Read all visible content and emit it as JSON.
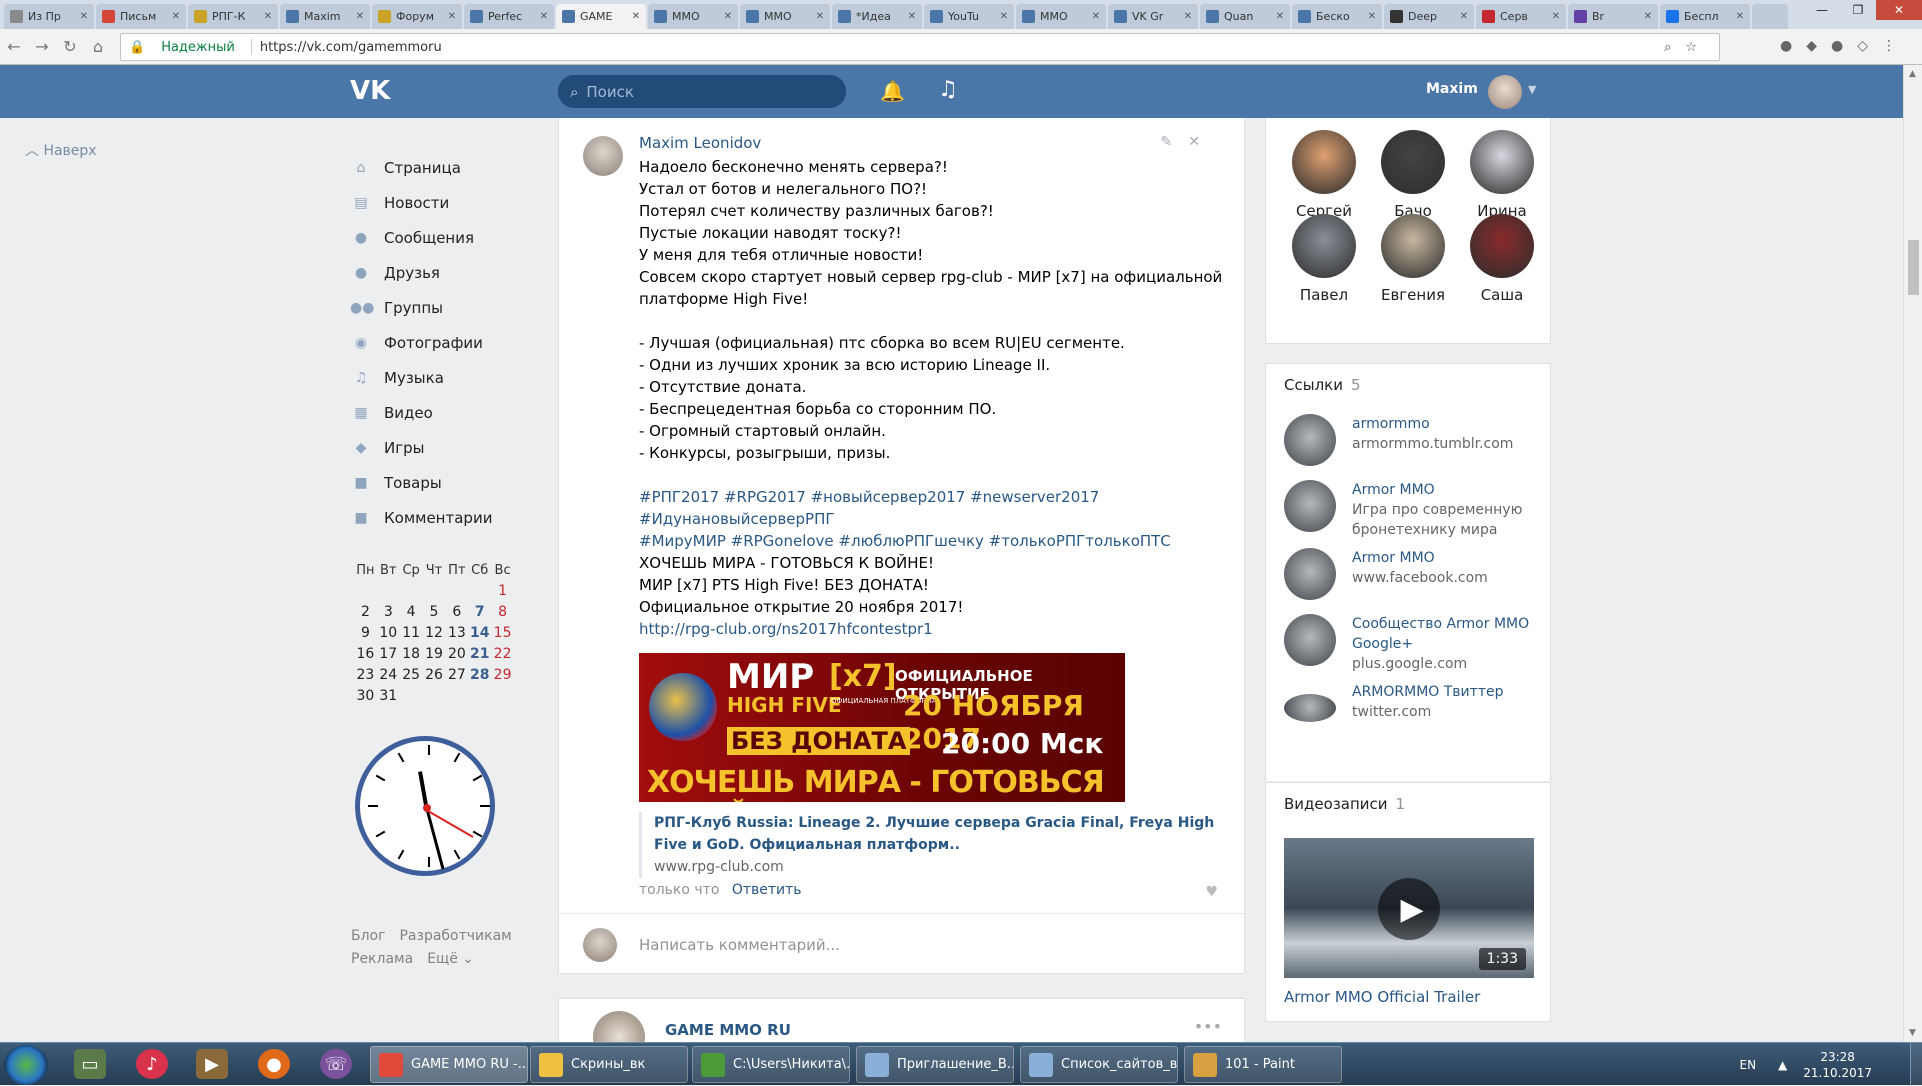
{
  "browser": {
    "tabs": [
      {
        "label": "Из Пр",
        "color": "#8a8a8a"
      },
      {
        "label": "Письм",
        "color": "#d44638"
      },
      {
        "label": "РПГ-К",
        "color": "#c9a227"
      },
      {
        "label": "Maxim",
        "color": "#4a76a8"
      },
      {
        "label": "Форум",
        "color": "#c9a227"
      },
      {
        "label": "Perfec",
        "color": "#4a76a8"
      },
      {
        "label": "GAME",
        "color": "#4a76a8"
      },
      {
        "label": "ММО",
        "color": "#4a76a8"
      },
      {
        "label": "ММО",
        "color": "#4a76a8"
      },
      {
        "label": "*Идеа",
        "color": "#4a76a8"
      },
      {
        "label": "YouTu",
        "color": "#4a76a8"
      },
      {
        "label": "ММО",
        "color": "#4a76a8"
      },
      {
        "label": "VK Gr",
        "color": "#4a76a8"
      },
      {
        "label": "Quan",
        "color": "#4a76a8"
      },
      {
        "label": "Беско",
        "color": "#4a76a8"
      },
      {
        "label": "Deep",
        "color": "#333333"
      },
      {
        "label": "Серв",
        "color": "#c4272d"
      },
      {
        "label": "Br",
        "color": "#6441a5"
      },
      {
        "label": "Беспл",
        "color": "#1a73e8"
      }
    ],
    "active_tab": 6,
    "secure_label": "Надежный",
    "url": "https://vk.com/gamemmoru",
    "window_controls": {
      "minimize": "—",
      "maximize": "❐",
      "close": "✕"
    }
  },
  "vk": {
    "logo": "VK",
    "search_placeholder": "Поиск",
    "user_name": "Maxim",
    "to_top": "Наверх",
    "menu": [
      {
        "label": "Страница",
        "icon": "home-icon",
        "glyph": "⌂"
      },
      {
        "label": "Новости",
        "icon": "news-icon",
        "glyph": "▤"
      },
      {
        "label": "Сообщения",
        "icon": "messages-icon",
        "glyph": "●"
      },
      {
        "label": "Друзья",
        "icon": "friends-icon",
        "glyph": "●"
      },
      {
        "label": "Группы",
        "icon": "groups-icon",
        "glyph": "●●"
      },
      {
        "label": "Фотографии",
        "icon": "camera-icon",
        "glyph": "◉"
      },
      {
        "label": "Музыка",
        "icon": "music-icon",
        "glyph": "♫"
      },
      {
        "label": "Видео",
        "icon": "video-icon",
        "glyph": "▦"
      },
      {
        "label": "Игры",
        "icon": "gamepad-icon",
        "glyph": "◆"
      },
      {
        "label": "Товары",
        "icon": "bag-icon",
        "glyph": "■"
      },
      {
        "label": "Комментарии",
        "icon": "comments-icon",
        "glyph": "■"
      }
    ],
    "calendar": {
      "header": [
        "Пн",
        "Вт",
        "Ср",
        "Чт",
        "Пт",
        "Сб",
        "Вс"
      ],
      "weeks": [
        [
          "",
          "",
          "",
          "",
          "",
          "",
          "1"
        ],
        [
          "2",
          "3",
          "4",
          "5",
          "6",
          "7",
          "8"
        ],
        [
          "9",
          "10",
          "11",
          "12",
          "13",
          "14",
          "15"
        ],
        [
          "16",
          "17",
          "18",
          "19",
          "20",
          "21",
          "22"
        ],
        [
          "23",
          "24",
          "25",
          "26",
          "27",
          "28",
          "29"
        ],
        [
          "30",
          "31",
          "",
          "",
          "",
          "",
          ""
        ]
      ]
    },
    "footer_links": [
      "Блог",
      "Разработчикам",
      "Реклама",
      "Ещё ⌄"
    ],
    "post": {
      "author": "Maxim Leonidov",
      "lines": [
        {
          "text": "Надоело бесконечно менять сервера?!"
        },
        {
          "text": "Устал от ботов и нелегального ПО?!"
        },
        {
          "text": "Потерял счет количеству различных багов?!"
        },
        {
          "text": "Пустые локации наводят тоску?!"
        },
        {
          "text": "У меня для тебя отличные новости!"
        },
        {
          "text": "Совсем скоро стартует новый сервер rpg-club - МИР [x7] на официальной"
        },
        {
          "text": "платформе High Five!"
        },
        {
          "text": ""
        },
        {
          "text": "- Лучшая (официальная) птс сборка во всем RU|EU сегменте."
        },
        {
          "text": "- Одни из лучших хроник за всю историю Lineage II."
        },
        {
          "text": "- Отсутствие доната."
        },
        {
          "text": "- Беспрецедентная борьба со сторонним ПО."
        },
        {
          "text": "- Огромный стартовый онлайн."
        },
        {
          "text": "- Конкурсы, розыгрыши, призы."
        },
        {
          "text": ""
        },
        {
          "text": "#РПГ2017 #RPG2017 #новыйсервер2017 #newserver2017",
          "tag": true
        },
        {
          "text": "#ИдунановыйсерверРПГ",
          "tag": true
        },
        {
          "text": "#МируМИР #RPGonelove #люблюРПГшечку #толькоРПГтолькоПТС",
          "tag": true
        },
        {
          "text": "ХОЧЕШЬ МИРА - ГОТОВЬСЯ К ВОЙНЕ!"
        },
        {
          "text": "МИР [x7] PTS High Five! БЕЗ ДОНАТА!"
        },
        {
          "text": "Официальное открытие 20 ноября 2017!"
        },
        {
          "text": "http://rpg-club.org/ns2017hfcontestpr1",
          "tag": true
        }
      ],
      "banner": {
        "mir": "МИР",
        "x7": "[x7]",
        "official_opening": "ОФИЦИАЛЬНОЕ ОТКРЫТИЕ",
        "high_five": "HIGH FIVE",
        "platform": "ОФИЦИАЛЬНАЯ ПЛАТФОРМА",
        "date": "20 НОЯБРЯ 2017",
        "no_donate": "БЕЗ ДОНАТА",
        "time": "20:00 Мск",
        "slogan": "ХОЧЕШЬ МИРА - ГОТОВЬСЯ К ВОЙНЕ"
      },
      "link_title": "РПГ-Клуб Russia: Lineage 2. Лучшие сервера Gracia Final, Freya High Five и GoD. Официальная платформ..",
      "link_domain": "www.rpg-club.com",
      "time": "только что",
      "reply": "Ответить",
      "comment_placeholder": "Написать комментарий..."
    },
    "next_post_author": "GAME MMO RU",
    "friends": [
      {
        "name": "Сергей",
        "color": "#e0a070"
      },
      {
        "name": "Бачо",
        "color": "#444444"
      },
      {
        "name": "Ирина",
        "color": "#d8d8e0"
      },
      {
        "name": "Павел",
        "color": "#8a9098"
      },
      {
        "name": "Евгения",
        "color": "#c8b8a0"
      },
      {
        "name": "Саша",
        "color": "#8a2a2a"
      }
    ],
    "links_section": {
      "title": "Ссылки",
      "count": "5",
      "items": [
        {
          "name": "armormmo",
          "desc": "armormmo.tumblr.com"
        },
        {
          "name": "Armor MMO",
          "desc": "Игра про современную бронетехнику мира"
        },
        {
          "name": "Armor MMO",
          "desc": "www.facebook.com"
        },
        {
          "name": "Сообщество Armor MMO Google+",
          "desc": "plus.google.com"
        },
        {
          "name": "ARMORMMO Твиттер",
          "desc": "twitter.com"
        }
      ]
    },
    "videos_section": {
      "title": "Видеозаписи",
      "count": "1",
      "video_title": "Armor MMO Official Trailer",
      "duration": "1:33"
    }
  },
  "taskbar": {
    "buttons": [
      {
        "label": "GAME MMO RU -...",
        "color": "#e04a3a"
      },
      {
        "label": "Скрины_вк",
        "color": "#f0c040"
      },
      {
        "label": "C:\\Users\\Никита\\...",
        "color": "#4a9a3a"
      },
      {
        "label": "Приглашение_В...",
        "color": "#8ab0d8"
      },
      {
        "label": "Список_сайтов_в...",
        "color": "#8ab0d8"
      },
      {
        "label": "101 - Paint",
        "color": "#d8a040"
      }
    ],
    "lang": "EN",
    "time": "23:28",
    "date": "21.10.2017"
  },
  "colors": {
    "vk_header": "#4a76a8",
    "link": "#2a5885"
  }
}
